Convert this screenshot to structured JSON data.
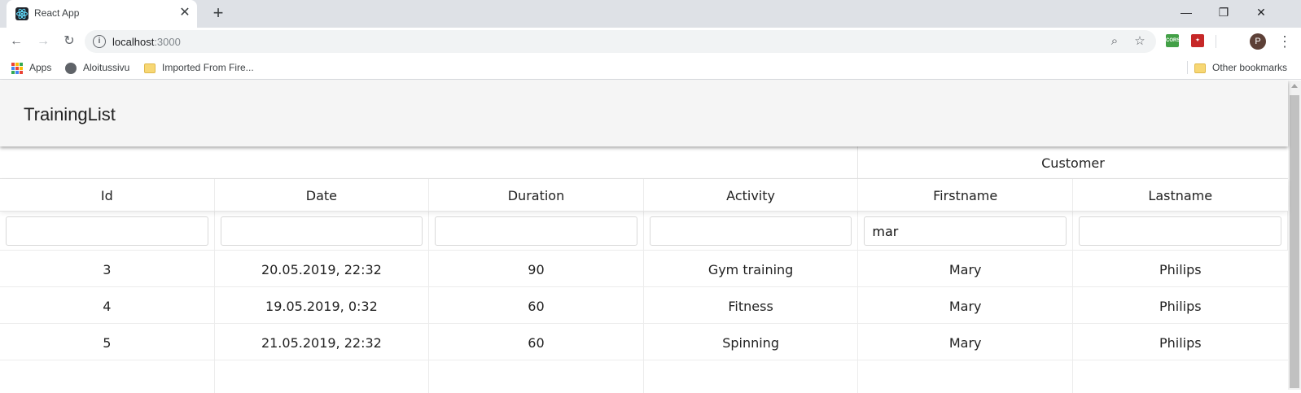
{
  "browser": {
    "tab_title": "React App",
    "url_host": "localhost",
    "url_port": ":3000",
    "avatar_initial": "P",
    "extension_cors_label": "CORS",
    "bookmarks": [
      {
        "label": "Apps",
        "icon": "apps-grid-icon"
      },
      {
        "label": "Aloitussivu",
        "icon": "globe-icon"
      },
      {
        "label": "Imported From Fire...",
        "icon": "folder-icon"
      }
    ],
    "other_bookmarks": "Other bookmarks"
  },
  "app": {
    "title": "TrainingList"
  },
  "table": {
    "group_header": "Customer",
    "columns": [
      "Id",
      "Date",
      "Duration",
      "Activity",
      "Firstname",
      "Lastname"
    ],
    "filters": [
      "",
      "",
      "",
      "",
      "mar",
      ""
    ],
    "rows": [
      [
        "3",
        "20.05.2019, 22:32",
        "90",
        "Gym training",
        "Mary",
        "Philips"
      ],
      [
        "4",
        "19.05.2019, 0:32",
        "60",
        "Fitness",
        "Mary",
        "Philips"
      ],
      [
        "5",
        "21.05.2019, 22:32",
        "60",
        "Spinning",
        "Mary",
        "Philips"
      ]
    ]
  },
  "colors": {
    "tabstrip": "#dee1e6",
    "appbar": "#f5f5f5"
  }
}
